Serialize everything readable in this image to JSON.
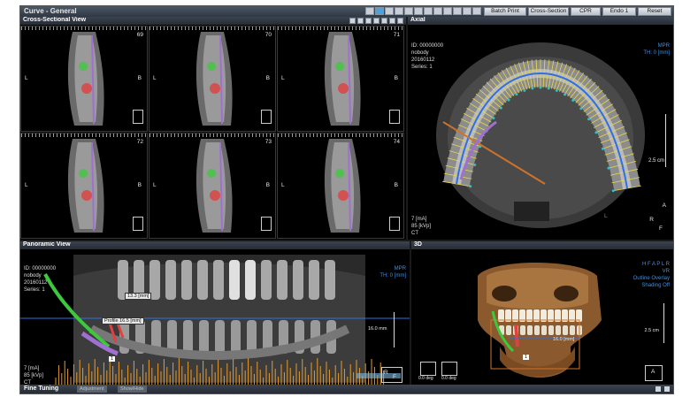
{
  "titlebar": {
    "title": "Curve - General",
    "buttons": [
      "Batch Print",
      "Cross-Section",
      "CPR",
      "Endo 1",
      "Reset"
    ]
  },
  "cross_sectional": {
    "title": "Cross-Sectional View",
    "slices": [
      {
        "num": "69",
        "left": "L",
        "right": "B"
      },
      {
        "num": "70",
        "left": "L",
        "right": "B"
      },
      {
        "num": "71",
        "left": "L",
        "right": "B"
      },
      {
        "num": "72",
        "left": "L",
        "right": "B"
      },
      {
        "num": "73",
        "left": "L",
        "right": "B"
      },
      {
        "num": "74",
        "left": "L",
        "right": "B"
      }
    ]
  },
  "axial": {
    "title": "Axial",
    "id": "ID: 00000000",
    "name": "nobody",
    "date": "20160112",
    "series": "Series: 1",
    "mode": "MPR",
    "thickness": "TH: 0 [mm]",
    "scale": "2.5 cm",
    "ma": "7 [mA]",
    "kvp": "85 [kVp]",
    "modality": "CT",
    "orient_a": "A",
    "orient_r": "R",
    "orient_f": "F",
    "side_l": "L"
  },
  "panoramic": {
    "title": "Panoramic View",
    "id": "ID: 00000000",
    "name": "nobody",
    "date": "20160112",
    "series": "Series: 1",
    "mode": "MPR",
    "thickness": "TH: 0 [mm]",
    "measure1": "13.3 [mm]",
    "measure2": "Profile 16.5 [mm]",
    "side": "1",
    "scale": "16.0 mm",
    "ma": "7 [mA]",
    "kvp": "85 [kVp]",
    "modality": "CT",
    "orient_r": "R",
    "orient_f": "F"
  },
  "view3d": {
    "title": "3D",
    "orientation": "H F A P L R",
    "mode": "VR",
    "overlay": "Outline Overlay",
    "shading": "Shading Off",
    "scale": "2.5 cm",
    "measure": "16.0 [mm]",
    "angle1": "0.0 deg",
    "angle2": "0.0 deg",
    "marker": "1",
    "orient_a": "A"
  },
  "bottom": {
    "title": "Fine Tuning",
    "tabs": [
      "Adjustment",
      "Show/Hide"
    ]
  }
}
